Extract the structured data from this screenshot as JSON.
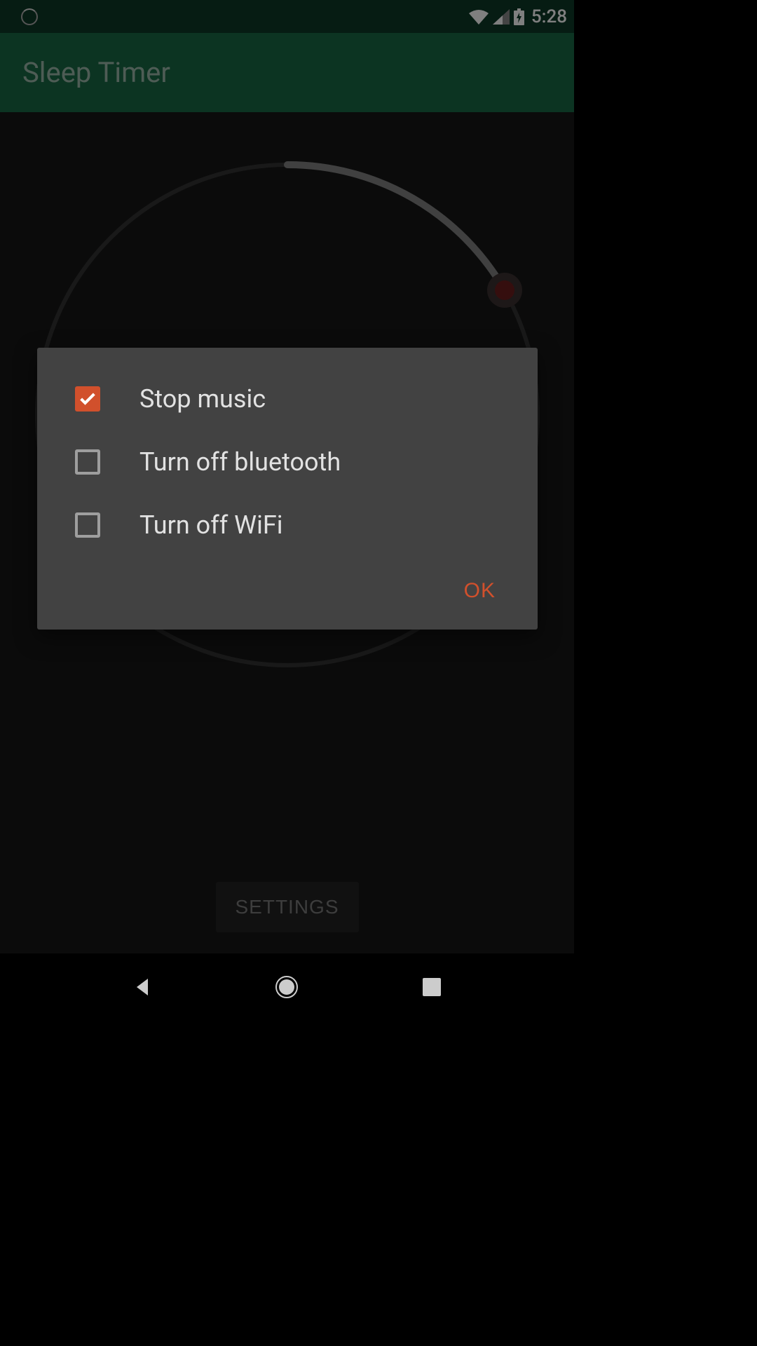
{
  "status_bar": {
    "clock": "5:28"
  },
  "app_bar": {
    "title": "Sleep Timer"
  },
  "main": {
    "settings_button_label": "SETTINGS"
  },
  "dialog": {
    "options": [
      {
        "label": "Stop music",
        "checked": true
      },
      {
        "label": "Turn off bluetooth",
        "checked": false
      },
      {
        "label": "Turn off WiFi",
        "checked": false
      }
    ],
    "ok_label": "OK"
  },
  "colors": {
    "accent": "#d1502c",
    "app_bar": "#196945",
    "status_bar": "#0d3926",
    "dialog_bg": "#424242"
  }
}
